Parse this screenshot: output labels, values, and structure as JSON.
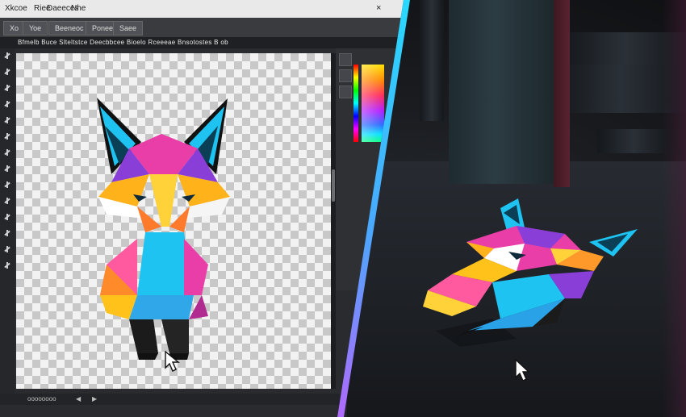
{
  "menu": {
    "items": [
      "Xkcoe",
      "Riee",
      "Daeeces",
      "Nhe"
    ]
  },
  "tabs": {
    "items": [
      "Xo",
      "Yoe",
      "Beeneoc",
      "Poneee",
      "Saee"
    ]
  },
  "options_bar": {
    "text": "Bfmelb Buce Slteltstce Deecbbcee Bioelo Rceeeae Bnsotostes B ob"
  },
  "status": {
    "text": "oooooooo"
  },
  "colors": {
    "menubar_bg": "#e9e9ea",
    "editor_bg": "#2a2b2e",
    "divider_cyan": "#29d9ff",
    "divider_violet": "#b069ff",
    "fox_cyan": "#1ec3f2",
    "fox_magenta": "#e93ea8",
    "fox_yellow": "#ffc21a",
    "fox_purple": "#8a3ed8"
  },
  "icons": {
    "tools": [
      "move-icon",
      "marquee-icon",
      "lasso-icon",
      "magic-wand-icon",
      "crop-icon",
      "eyedropper-icon",
      "healing-icon",
      "brush-icon",
      "stamp-icon",
      "history-brush-icon",
      "eraser-icon",
      "gradient-icon",
      "blur-icon",
      "dodge-icon",
      "pen-icon",
      "type-icon",
      "path-select-icon",
      "shape-icon",
      "hand-icon",
      "zoom-icon",
      "color-swatch-icon"
    ],
    "panel": [
      "panel-color-icon",
      "panel-swatches-icon",
      "panel-layers-icon"
    ]
  }
}
